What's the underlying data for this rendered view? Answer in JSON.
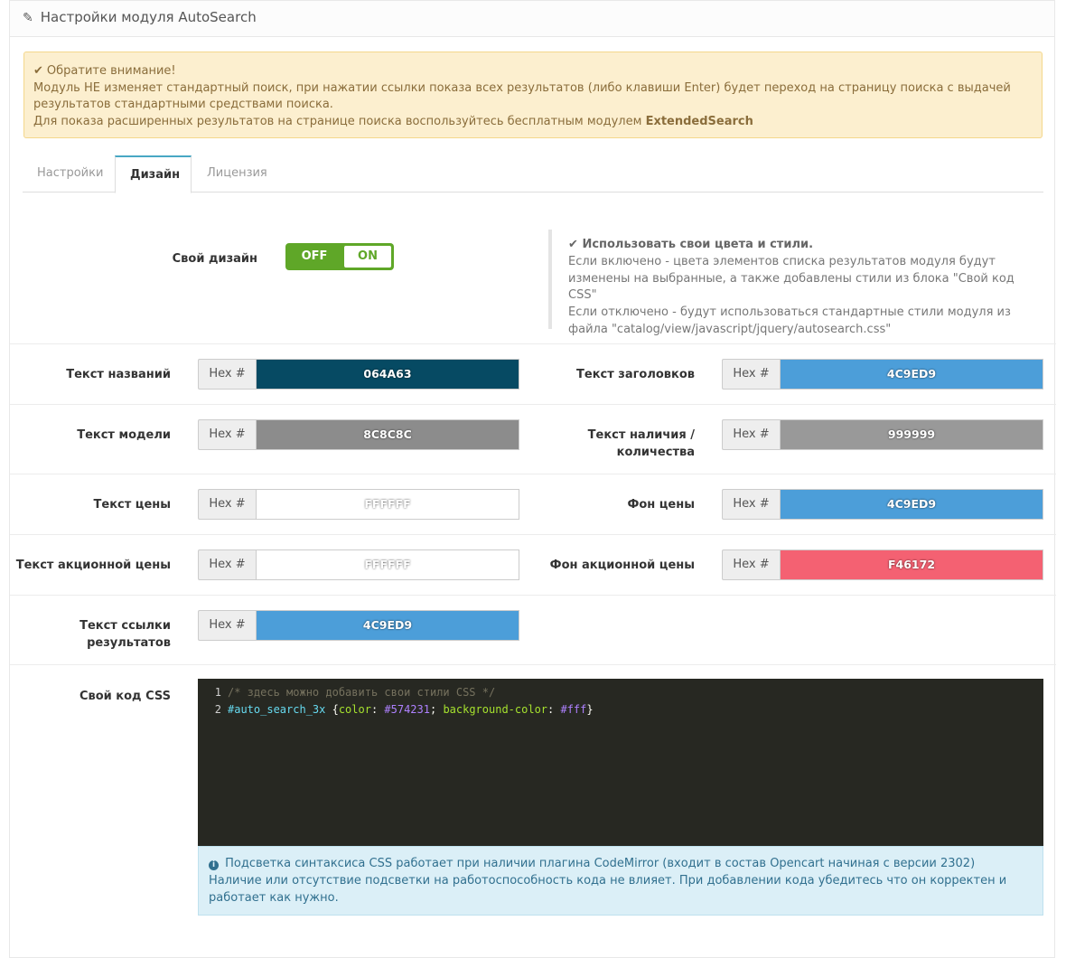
{
  "header": {
    "title": "Настройки модуля AutoSearch"
  },
  "warning": {
    "title": "Обратите внимание!",
    "line1": "Модуль НЕ изменяет стандартный поиск, при нажатии ссылки показа всех результатов (либо клавиши Enter) будет переход на страницу поиска с выдачей результатов стандартными средствами поиска.",
    "line2": "Для показа расширенных результатов на странице поиска воспользуйтесь бесплатным модулем",
    "link": "ExtendedSearch"
  },
  "tabs": [
    {
      "label": "Настройки",
      "active": false
    },
    {
      "label": "Дизайн",
      "active": true
    },
    {
      "label": "Лицензия",
      "active": false
    }
  ],
  "design_switch": {
    "label": "Свой дизайн",
    "off": "OFF",
    "on": "ON",
    "state": "ON",
    "help_title": "Использовать свои цвета и стили.",
    "help_line1": "Если включено - цвета элементов списка результатов модуля будут изменены на выбранные, а также добавлены стили из блока \"Свой код CSS\"",
    "help_line2": "Если отключено - будут использоваться стандартные стили модуля из файла \"catalog/view/javascript/jquery/autosearch.css\""
  },
  "hex_prefix": "Hex #",
  "colors": {
    "name_text": {
      "label": "Текст названий",
      "value": "064A63",
      "bg": "#064A63"
    },
    "heading_text": {
      "label": "Текст заголовков",
      "value": "4C9ED9",
      "bg": "#4C9ED9"
    },
    "model_text": {
      "label": "Текст модели",
      "value": "8C8C8C",
      "bg": "#8C8C8C"
    },
    "stock_text": {
      "label1": "Текст наличия /",
      "label2": "количества",
      "value": "999999",
      "bg": "#999999"
    },
    "price_text": {
      "label": "Текст цены",
      "value": "FFFFFF",
      "bg": "#FFFFFF"
    },
    "price_bg": {
      "label": "Фон цены",
      "value": "4C9ED9",
      "bg": "#4C9ED9"
    },
    "special_text": {
      "label": "Текст акционной цены",
      "value": "FFFFFF",
      "bg": "#FFFFFF"
    },
    "special_bg": {
      "label": "Фон акционной цены",
      "value": "F46172",
      "bg": "#F46172"
    },
    "results_link": {
      "label1": "Текст ссылки",
      "label2": "результатов",
      "value": "4C9ED9",
      "bg": "#4C9ED9"
    }
  },
  "css_code": {
    "label": "Свой код CSS",
    "line1_no": "1",
    "line1": "/* здесь можно добавить свои стили CSS */",
    "line2_no": "2",
    "line2_selector": "#auto_search_3x",
    "line2_open": " {",
    "line2_prop1": "color",
    "line2_colon1": ": ",
    "line2_val1": "#574231",
    "line2_semi": "; ",
    "line2_prop2": "background-color",
    "line2_colon2": ": ",
    "line2_val2": "#fff",
    "line2_close": "}"
  },
  "code_info": {
    "line1": "Подсветка синтаксиса CSS работает при наличии плагина CodeMirror (входит в состав Opencart начиная с версии 2302)",
    "line2": "Наличие или отсутствие подсветки на работоспособность кода не влияет. При добавлении кода убедитесь что он корректен и работает как нужно."
  }
}
